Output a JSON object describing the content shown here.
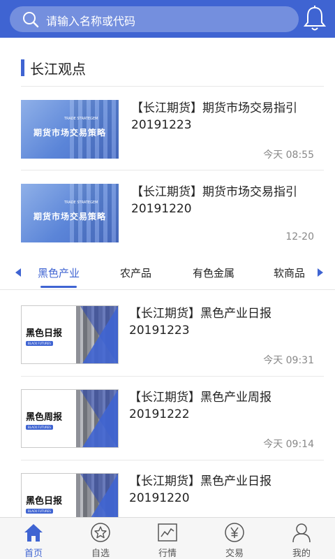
{
  "search": {
    "placeholder": "请输入名称或代码",
    "icon": "search-icon"
  },
  "header": {
    "notification_icon": "bell-icon"
  },
  "colors": {
    "primary": "#3f64d2",
    "text": "#222222",
    "muted": "#888888"
  },
  "section": {
    "title": "长江观点"
  },
  "viewpoints": [
    {
      "title": "【长江期货】期货市场交易指引20191223",
      "time": "今天 08:55",
      "thumb_label": "期货市场交易策略",
      "thumb_sub": "TRADE STRATEGEM"
    },
    {
      "title": "【长江期货】期货市场交易指引20191220",
      "time": "12-20",
      "thumb_label": "期货市场交易策略",
      "thumb_sub": "TRADE STRATEGEM"
    }
  ],
  "tabs": {
    "items": [
      "黑色产业",
      "农产品",
      "有色金属",
      "软商品"
    ],
    "active_index": 0
  },
  "reports": [
    {
      "title": "【长江期货】黑色产业日报20191223",
      "time": "今天 09:31",
      "thumb_label": "黑色日报",
      "thumb_sub": "BLACK FUTURES"
    },
    {
      "title": "【长江期货】黑色产业周报20191222",
      "time": "今天 09:14",
      "thumb_label": "黑色周报",
      "thumb_sub": "BLACK FUTURES"
    },
    {
      "title": "【长江期货】黑色产业日报20191220",
      "time": "",
      "thumb_label": "黑色日报",
      "thumb_sub": "BLACK FUTURES"
    }
  ],
  "nav": {
    "items": [
      {
        "label": "首页",
        "icon": "home-icon"
      },
      {
        "label": "自选",
        "icon": "star-icon"
      },
      {
        "label": "行情",
        "icon": "chart-icon"
      },
      {
        "label": "交易",
        "icon": "yen-icon"
      },
      {
        "label": "我的",
        "icon": "user-icon"
      }
    ],
    "active_index": 0
  }
}
